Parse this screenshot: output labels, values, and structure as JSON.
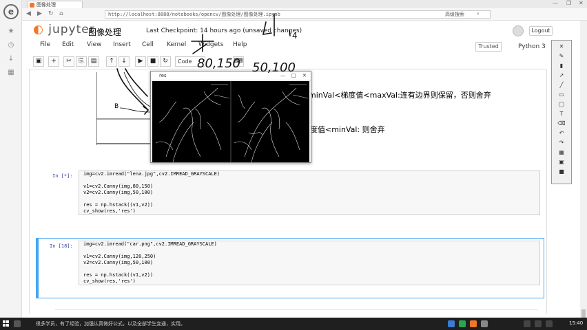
{
  "browser": {
    "tab_title": "图像处理",
    "url": "http://localhost:8888/notebooks/opencv/图像处理/图像处理.ipynb",
    "right_text": "高级搜索",
    "window_controls": [
      "—",
      "❐",
      "✕"
    ]
  },
  "jupyter": {
    "logo_text": "jupyter",
    "notebook_title": "图像处理",
    "checkpoint": "Last Checkpoint: 14 hours ago (unsaved changes)",
    "logout_label": "Logout",
    "menu": [
      "File",
      "Edit",
      "View",
      "Insert",
      "Cell",
      "Kernel",
      "Widgets",
      "Help"
    ],
    "trusted_label": "Trusted",
    "kernel_name": "Python 3",
    "toolbar": {
      "cell_type": "Code",
      "buttons": [
        "save-icon",
        "add-icon",
        "cut-icon",
        "copy-icon",
        "paste-icon",
        "move-up-icon",
        "move-down-icon",
        "run-icon",
        "stop-icon",
        "restart-icon",
        "keyboard-icon"
      ]
    }
  },
  "markdown": {
    "line1": "minVal<梯度值<maxVal:连有边界则保留，否则舍弃",
    "line2": "度值<minVal: 则舍弃",
    "diagram_label": "B"
  },
  "cells": [
    {
      "prompt": "In [*]:",
      "code": [
        "img=cv2.imread(\"lena.jpg\",cv2.IMREAD_GRAYSCALE)",
        "",
        "v1=cv2.Canny(img,80,150)",
        "v2=cv2.Canny(img,50,100)",
        "",
        "res = np.hstack((v1,v2))",
        "cv_show(res,'res')"
      ]
    },
    {
      "prompt": "In [18]:",
      "code": [
        "img=cv2.imread(\"car.png\",cv2.IMREAD_GRAYSCALE)",
        "",
        "v1=cv2.Canny(img,120,250)",
        "v2=cv2.Canny(img,50,100)",
        "",
        "res = np.hstack((v1,v2))",
        "cv_show(res,'res')"
      ]
    }
  ],
  "popup": {
    "title": "res",
    "controls": [
      "—",
      "□",
      "✕"
    ]
  },
  "annotations": {
    "handwritten": [
      "4",
      "80,150",
      "50,100"
    ]
  },
  "taskbar": {
    "notice": "很多学员，有了经验，加强认真做好公式，以及全部学生变通，实用。",
    "time": "15:40"
  },
  "colors": {
    "accent": "#f37626",
    "selected_cell": "#42a5f5",
    "prompt": "#303f9f"
  }
}
